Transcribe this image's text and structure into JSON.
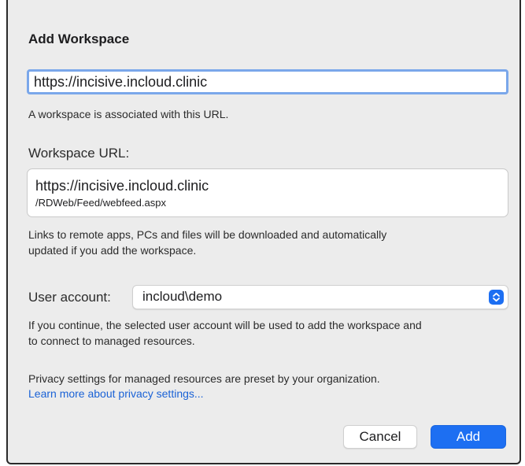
{
  "dialog": {
    "title": "Add Workspace",
    "url_input_value": "https://incisive.incloud.clinic",
    "url_hint": "A workspace is associated with this URL.",
    "workspace_url_label": "Workspace URL:",
    "workspace_url_line1": "https://incisive.incloud.clinic",
    "workspace_url_line2": "/RDWeb/Feed/webfeed.aspx",
    "links_desc_line1": "Links to remote apps, PCs and files will be downloaded and automatically",
    "links_desc_line2": "updated if you add the workspace.",
    "user_account_label": "User account:",
    "user_account_selected": "incloud\\demo",
    "continue_desc_line1": "If you continue, the selected user account will be used to add the workspace and",
    "continue_desc_line2": "to connect to managed resources.",
    "privacy_desc": "Privacy settings for managed resources are preset by your organization.",
    "privacy_link": "Learn more about privacy settings...",
    "cancel_label": "Cancel",
    "add_label": "Add"
  },
  "colors": {
    "accent": "#1d6ff2",
    "link": "#1a62d6",
    "focus_ring": "#7aa7ea",
    "dialog_bg": "#ececec"
  },
  "icons": {
    "select_arrows": "chevron-up-down-icon"
  }
}
